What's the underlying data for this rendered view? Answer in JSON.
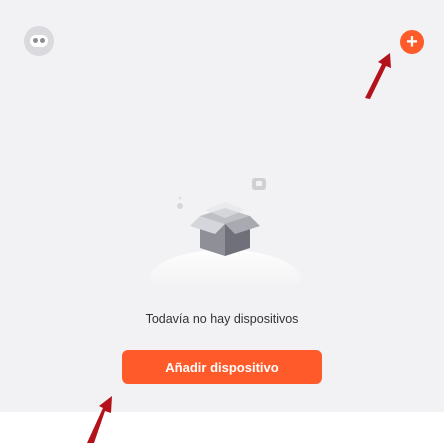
{
  "header": {
    "avatar_icon": "robot-avatar-icon",
    "add_icon": "plus-circle-icon",
    "add_symbol": "+"
  },
  "empty_state": {
    "message": "Todavía no hay dispositivos",
    "illustration": "empty-box-illustration"
  },
  "actions": {
    "add_device_label": "Añadir dispositivo"
  },
  "colors": {
    "accent": "#ff5a2a",
    "background": "#f2f2f4",
    "annotation_arrow": "#b3121b"
  }
}
